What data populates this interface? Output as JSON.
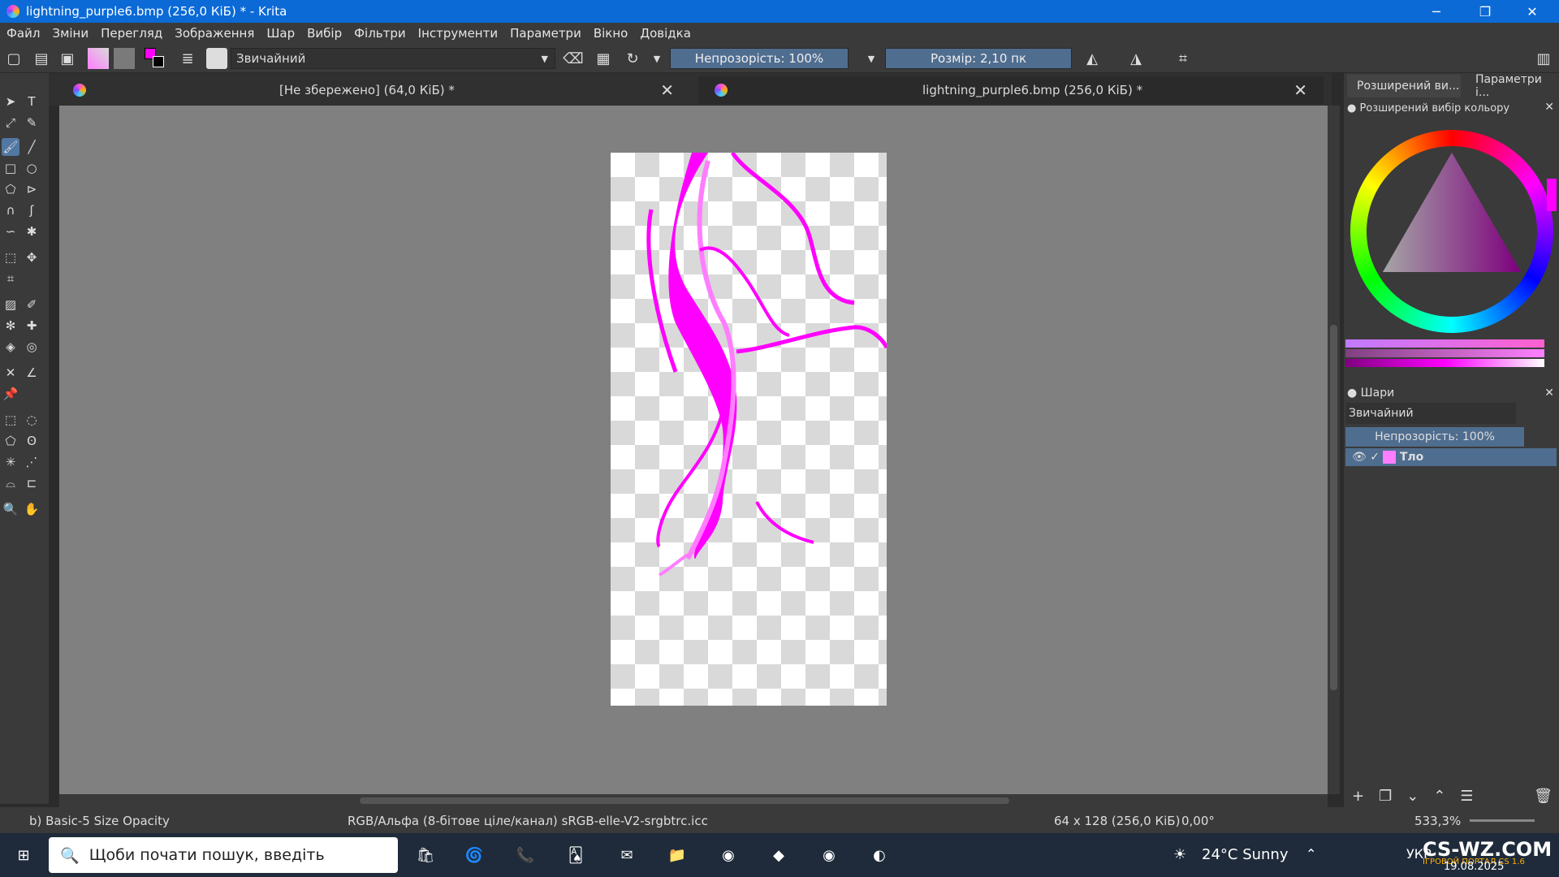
{
  "window": {
    "title": "lightning_purple6.bmp (256,0 КіБ) * - Krita",
    "minimize": "─",
    "maximize": "❐",
    "close": "✕"
  },
  "menu": [
    "Файл",
    "Зміни",
    "Перегляд",
    "Зображення",
    "Шар",
    "Вибір",
    "Фільтри",
    "Інструменти",
    "Параметри",
    "Вікно",
    "Довідка"
  ],
  "toolbar": {
    "blend_mode": "Звичайний",
    "opacity": "Непрозорість: 100%",
    "size": "Розмір: 2,10 пк"
  },
  "tabs": [
    {
      "label": "[Не збережено]  (64,0 КіБ) *"
    },
    {
      "label": "lightning_purple6.bmp (256,0 КіБ) *"
    }
  ],
  "docker": {
    "tab1": "Розширений ви...",
    "tab2": "Параметри і...",
    "color_title": "Розширений вибір кольору",
    "layers_title": "Шари",
    "blend": "Звичайний",
    "opacity": "Непрозорість:  100%",
    "layer_name": "Тло"
  },
  "status": {
    "brush": "b) Basic-5 Size Opacity",
    "color_space": "RGB/Альфа (8-бітове ціле/канал)  sRGB-elle-V2-srgbtrc.icc",
    "dims": "64 x 128 (256,0 КіБ)",
    "rotation": "0,00°",
    "zoom": "533,3%"
  },
  "taskbar": {
    "search": "Щоби почати пошук, введіть",
    "weather": "24°C  Sunny",
    "lang": "УКР",
    "date": "19.08.2025",
    "watermark": "CS-WZ.COM",
    "watermark_sub": "ІГРОВОЙ ПОРТАЛ CS 1.6"
  },
  "colors": {
    "accent": "#0b6ad6",
    "stroke": "#ff00ff",
    "stroke_light": "#ff7dff"
  }
}
